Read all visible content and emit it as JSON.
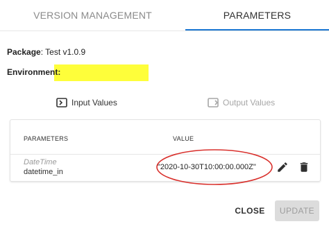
{
  "tabs": {
    "version_management": "VERSION MANAGEMENT",
    "parameters": "PARAMETERS",
    "active": "parameters"
  },
  "info": {
    "package_label": "Package",
    "package_value": ": Test v1.0.9",
    "environment_label": "Environment:",
    "environment_value": ""
  },
  "io": {
    "input_label": "Input Values",
    "output_label": "Output Values",
    "input_icon": "input-icon",
    "output_icon": "output-icon",
    "selected": "input"
  },
  "table": {
    "headers": {
      "parameters": "PARAMETERS",
      "value": "VALUE"
    },
    "rows": [
      {
        "type": "DateTime",
        "name": "datetime_in",
        "value": "\"2020-10-30T10:00:00.000Z\""
      }
    ]
  },
  "footer": {
    "close_label": "CLOSE",
    "update_label": "UPDATE",
    "update_disabled": true
  },
  "colors": {
    "accent": "#1976d2",
    "highlight": "#fefe3a",
    "annotation": "#d9302c"
  }
}
